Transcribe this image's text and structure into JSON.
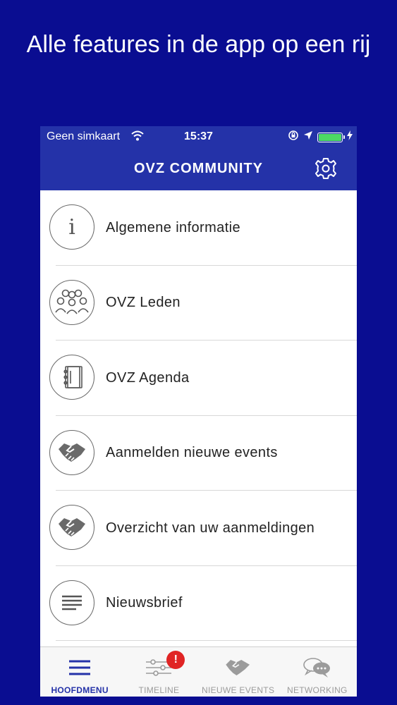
{
  "promo": {
    "headline": "Alle features in de app op een rij"
  },
  "statusbar": {
    "carrier": "Geen simkaart",
    "time": "15:37",
    "battery_level": 1.0
  },
  "navbar": {
    "title": "OVZ COMMUNITY"
  },
  "menu": {
    "items": [
      {
        "label": "Algemene informatie",
        "icon": "info-icon"
      },
      {
        "label": "OVZ Leden",
        "icon": "members-icon"
      },
      {
        "label": "OVZ Agenda",
        "icon": "agenda-icon"
      },
      {
        "label": "Aanmelden nieuwe events",
        "icon": "handshake-icon"
      },
      {
        "label": "Overzicht van uw aanmeldingen",
        "icon": "handshake-icon"
      },
      {
        "label": "Nieuwsbrief",
        "icon": "newsletter-icon"
      }
    ]
  },
  "tabbar": {
    "tabs": [
      {
        "label": "HOOFDMENU",
        "icon": "hamburger-icon",
        "active": true
      },
      {
        "label": "TIMELINE",
        "icon": "sliders-icon",
        "badge": "!"
      },
      {
        "label": "NIEUWE EVENTS",
        "icon": "handshake-icon"
      },
      {
        "label": "NETWORKING",
        "icon": "chat-bubbles-icon"
      }
    ]
  },
  "colors": {
    "background": "#0a0d91",
    "header": "#2432a8",
    "badge": "#e02424",
    "battery": "#4cd964",
    "tab_active": "#2432a8",
    "tab_inactive": "#9b9b9b"
  }
}
